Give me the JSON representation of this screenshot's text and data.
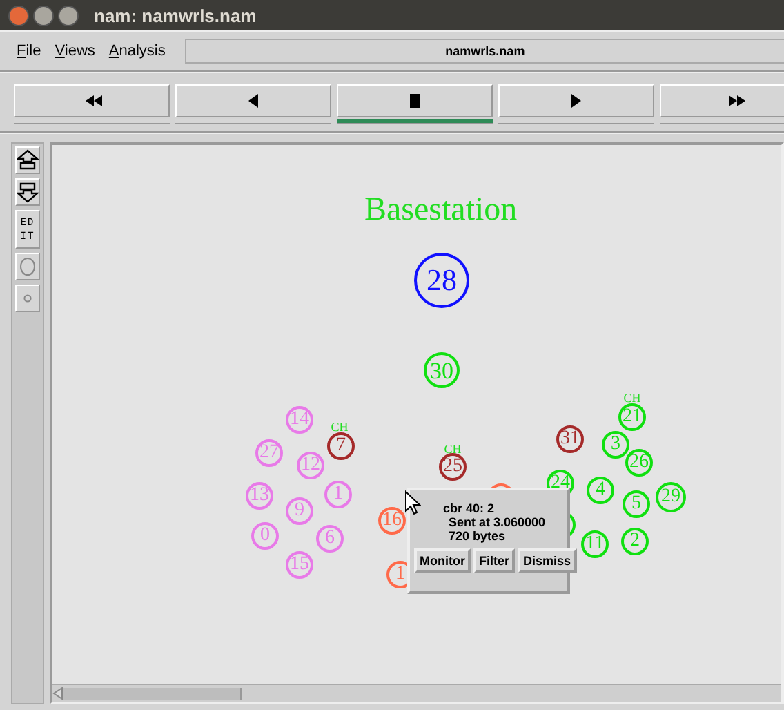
{
  "window": {
    "title": "nam: namwrls.nam"
  },
  "menu": [
    {
      "label": "File"
    },
    {
      "label": "Views"
    },
    {
      "label": "Analysis"
    }
  ],
  "file_name": "namwrls.nam",
  "playback": [
    {
      "kind": "rewind",
      "selected": false
    },
    {
      "kind": "back",
      "selected": false
    },
    {
      "kind": "stop",
      "selected": true
    },
    {
      "kind": "play",
      "selected": false
    },
    {
      "kind": "forward",
      "selected": false
    }
  ],
  "tools": [
    {
      "kind": "zoom-in"
    },
    {
      "kind": "zoom-out"
    },
    {
      "kind": "edit",
      "label": "ED IT"
    },
    {
      "kind": "big-circle"
    },
    {
      "kind": "small-circle"
    }
  ],
  "canvas": {
    "title": "Basestation",
    "base_nodes": [
      {
        "label": "28",
        "color": "#1010ff"
      },
      {
        "label": "30",
        "color": "#10e010"
      }
    ],
    "clusters": [
      {
        "head_label": "CH",
        "nodes": [
          {
            "label": "14",
            "color": "#e87ae8"
          },
          {
            "label": "27",
            "color": "#e87ae8"
          },
          {
            "label": "7",
            "color": "#a52a2a"
          },
          {
            "label": "12",
            "color": "#e87ae8"
          },
          {
            "label": "13",
            "color": "#e87ae8"
          },
          {
            "label": "1",
            "color": "#e87ae8"
          },
          {
            "label": "9",
            "color": "#e87ae8"
          },
          {
            "label": "0",
            "color": "#e87ae8"
          },
          {
            "label": "6",
            "color": "#e87ae8"
          },
          {
            "label": "15",
            "color": "#e87ae8"
          }
        ]
      },
      {
        "head_label": "CH",
        "nodes": [
          {
            "label": "25",
            "color": "#a52a2a"
          },
          {
            "color": "#ff6a4a"
          },
          {
            "label": "16",
            "color": "#ff6a4a"
          },
          {
            "label": "1",
            "color": "#ff6a4a"
          }
        ]
      },
      {
        "head_label": "CH",
        "nodes": [
          {
            "label": "21",
            "color": "#10e010"
          },
          {
            "label": "31",
            "color": "#a52a2a"
          },
          {
            "label": "3",
            "color": "#10e010"
          },
          {
            "label": "26",
            "color": "#10e010"
          },
          {
            "label": "24",
            "color": "#10e010"
          },
          {
            "label": "4",
            "color": "#10e010"
          },
          {
            "label": "5",
            "color": "#10e010"
          },
          {
            "label": "29",
            "color": "#10e010"
          },
          {
            "color": "#10e010"
          },
          {
            "label": "11",
            "color": "#10e010"
          },
          {
            "label": "2",
            "color": "#10e010"
          }
        ]
      }
    ],
    "popup": {
      "lines": [
        "cbr 40: 2",
        "Sent at 3.060000",
        "720 bytes"
      ],
      "buttons": [
        "Monitor",
        "Filter",
        "Dismiss"
      ]
    }
  }
}
